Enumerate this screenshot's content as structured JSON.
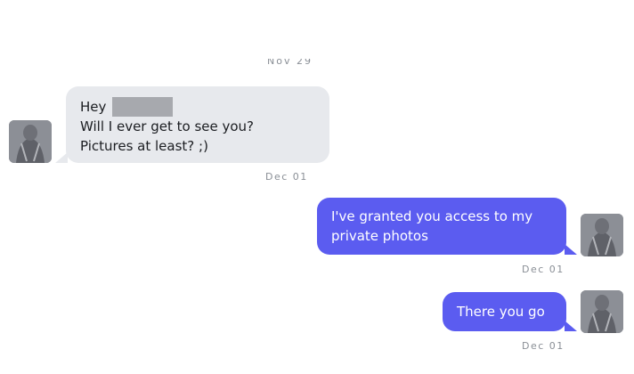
{
  "chat": {
    "date_top": "Nov 29",
    "messages": [
      {
        "direction": "incoming",
        "lines": [
          "Hey",
          "Will I ever get to see you?",
          "Pictures at least? ;)"
        ],
        "timestamp": "Dec 01"
      },
      {
        "direction": "outgoing",
        "lines": [
          "I've granted you access to my",
          "private photos"
        ],
        "timestamp": "Dec 01"
      },
      {
        "direction": "outgoing",
        "lines": [
          "There you go"
        ],
        "timestamp": "Dec 01"
      }
    ]
  },
  "colors": {
    "incoming_bubble": "#e7e9ed",
    "outgoing_bubble": "#5b5cf0",
    "timestamp_text": "#8a8f96"
  },
  "icons": {
    "incoming_avatar": "avatar-photo",
    "outgoing_avatar": "avatar-photo"
  }
}
